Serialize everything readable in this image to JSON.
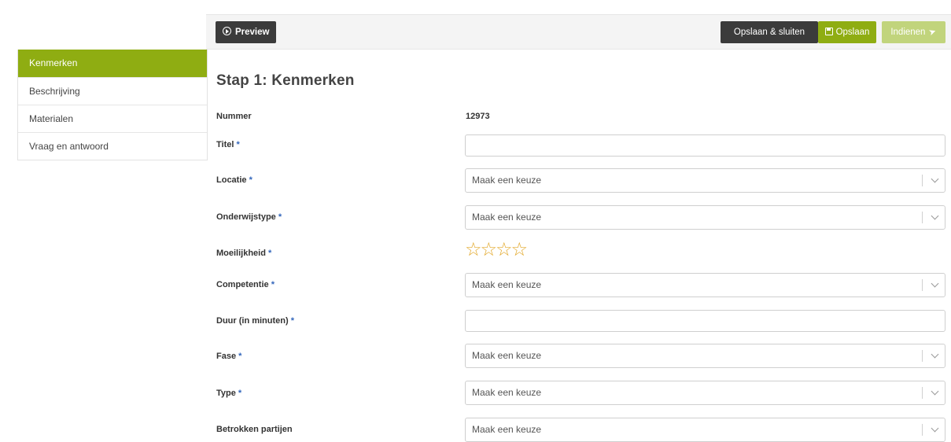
{
  "sidebar": {
    "items": [
      {
        "label": "Kenmerken",
        "active": true
      },
      {
        "label": "Beschrijving",
        "active": false
      },
      {
        "label": "Materialen",
        "active": false
      },
      {
        "label": "Vraag en antwoord",
        "active": false
      }
    ]
  },
  "toolbar": {
    "preview_label": "Preview",
    "save_close_label": "Opslaan & sluiten",
    "save_label": "Opslaan",
    "submit_label": "Indienen"
  },
  "page": {
    "title": "Stap 1: Kenmerken"
  },
  "form": {
    "nummer": {
      "label": "Nummer",
      "value": "12973"
    },
    "titel": {
      "label": "Titel",
      "required": "*",
      "value": ""
    },
    "locatie": {
      "label": "Locatie",
      "required": "*",
      "placeholder": "Maak een keuze"
    },
    "onderwijstype": {
      "label": "Onderwijstype",
      "required": "*",
      "placeholder": "Maak een keuze"
    },
    "moeilijkheid": {
      "label": "Moeilijkheid",
      "required": "*",
      "rating": 0,
      "max": 4
    },
    "competentie": {
      "label": "Competentie",
      "required": "*",
      "placeholder": "Maak een keuze"
    },
    "duur": {
      "label": "Duur (in minuten)",
      "required": "*",
      "value": ""
    },
    "fase": {
      "label": "Fase",
      "required": "*",
      "placeholder": "Maak een keuze"
    },
    "type": {
      "label": "Type",
      "required": "*",
      "placeholder": "Maak een keuze"
    },
    "betrokken": {
      "label": "Betrokken partijen",
      "placeholder": "Maak een keuze"
    }
  },
  "colors": {
    "accent": "#8fad12",
    "accent_light": "#c1d47c",
    "dark_button": "#3b3b3b",
    "star": "#e3a92c",
    "required": "#3366bb"
  }
}
